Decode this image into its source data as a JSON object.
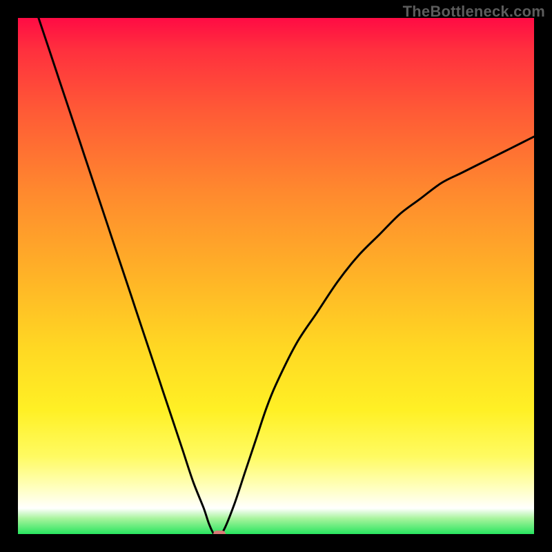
{
  "watermark": "TheBottleneck.com",
  "chart_data": {
    "type": "line",
    "title": "",
    "xlabel": "",
    "ylabel": "",
    "xlim": [
      0,
      100
    ],
    "ylim": [
      0,
      100
    ],
    "grid": false,
    "legend": false,
    "series": [
      {
        "name": "bottleneck-curve",
        "x": [
          4,
          6,
          8,
          10,
          12,
          14,
          16,
          18,
          20,
          22,
          24,
          26,
          28,
          30,
          32,
          34,
          36,
          37,
          38,
          39,
          40,
          42,
          44,
          46,
          48,
          50,
          54,
          58,
          62,
          66,
          70,
          74,
          78,
          82,
          86,
          90,
          94,
          98,
          100
        ],
        "y": [
          100,
          94,
          88,
          82,
          76,
          70,
          64,
          58,
          52,
          46,
          40,
          34,
          28,
          22,
          16,
          10,
          5,
          2,
          0,
          0,
          1,
          6,
          12,
          18,
          24,
          29,
          37,
          43,
          49,
          54,
          58,
          62,
          65,
          68,
          70,
          72,
          74,
          76,
          77
        ]
      }
    ],
    "marker": {
      "x": 39,
      "y": 0,
      "color": "#d97a77"
    },
    "background_gradient_stops": [
      {
        "pos": 0,
        "color": "#ff0b44"
      },
      {
        "pos": 50,
        "color": "#ffb327"
      },
      {
        "pos": 76,
        "color": "#fff025"
      },
      {
        "pos": 95,
        "color": "#ffffff"
      },
      {
        "pos": 100,
        "color": "#28e55f"
      }
    ]
  }
}
